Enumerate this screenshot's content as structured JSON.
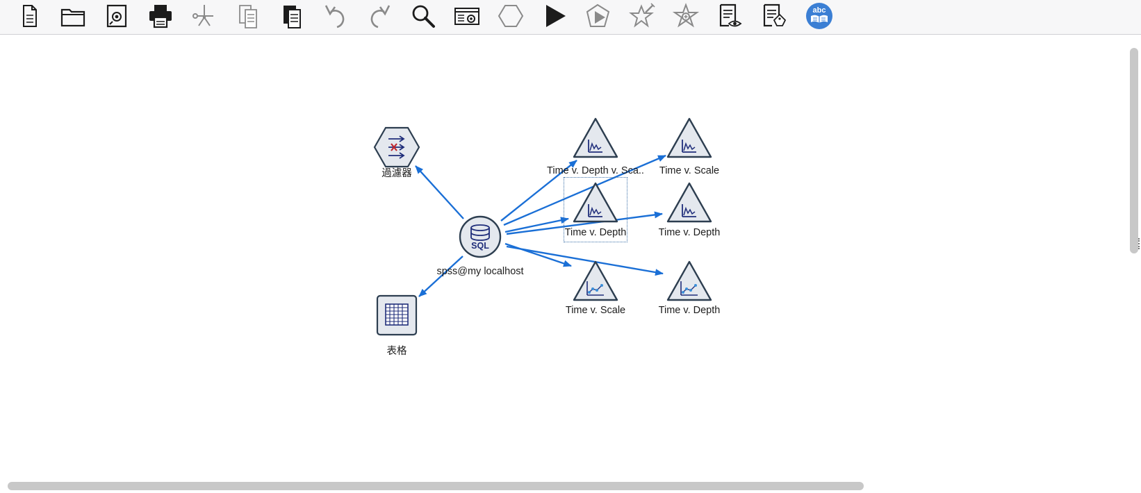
{
  "toolbar": {
    "buttons": [
      {
        "id": "new",
        "icon": "new-file-icon",
        "enabled": true
      },
      {
        "id": "open",
        "icon": "open-folder-icon",
        "enabled": true
      },
      {
        "id": "save",
        "icon": "save-icon",
        "enabled": true
      },
      {
        "id": "print",
        "icon": "print-icon",
        "enabled": true
      },
      {
        "id": "cut",
        "icon": "cut-icon",
        "enabled": false
      },
      {
        "id": "copy",
        "icon": "copy-icon",
        "enabled": false
      },
      {
        "id": "paste",
        "icon": "paste-icon",
        "enabled": true
      },
      {
        "id": "undo",
        "icon": "undo-icon",
        "enabled": false
      },
      {
        "id": "redo",
        "icon": "redo-icon",
        "enabled": false
      },
      {
        "id": "search",
        "icon": "search-icon",
        "enabled": true
      },
      {
        "id": "stream-properties",
        "icon": "stream-properties-icon",
        "enabled": true
      },
      {
        "id": "supernode",
        "icon": "supernode-icon",
        "enabled": false
      },
      {
        "id": "run",
        "icon": "run-icon",
        "enabled": true
      },
      {
        "id": "run-selection",
        "icon": "run-selection-icon",
        "enabled": false
      },
      {
        "id": "model-star",
        "icon": "star-wand-icon",
        "enabled": false
      },
      {
        "id": "model-zoom",
        "icon": "star-zoom-icon",
        "enabled": false
      },
      {
        "id": "preview",
        "icon": "preview-icon",
        "enabled": true
      },
      {
        "id": "annotate",
        "icon": "annotate-icon",
        "enabled": true
      },
      {
        "id": "text-analytics",
        "icon": "text-analytics-icon",
        "enabled": true
      }
    ],
    "text_analytics_label": "abc"
  },
  "stream": {
    "source": {
      "label": "spss@my localhost",
      "icon_text": "SQL"
    },
    "nodes": [
      {
        "id": "filter",
        "label": "過濾器",
        "type": "filter"
      },
      {
        "id": "table",
        "label": "表格",
        "type": "table"
      },
      {
        "id": "plot1",
        "label": "Time v. Depth v. Sca..",
        "type": "plot"
      },
      {
        "id": "plot2",
        "label": "Time v. Scale",
        "type": "plot"
      },
      {
        "id": "plot3",
        "label": "Time v. Depth",
        "type": "plot",
        "selected": true
      },
      {
        "id": "plot4",
        "label": "Time v. Depth",
        "type": "plot"
      },
      {
        "id": "plot5",
        "label": "Time v. Scale",
        "type": "multiplot"
      },
      {
        "id": "plot6",
        "label": "Time v. Depth",
        "type": "multiplot"
      }
    ],
    "connections": [
      {
        "from": "source",
        "to": "filter"
      },
      {
        "from": "source",
        "to": "table"
      },
      {
        "from": "source",
        "to": "plot1"
      },
      {
        "from": "source",
        "to": "plot2"
      },
      {
        "from": "source",
        "to": "plot3"
      },
      {
        "from": "source",
        "to": "plot4"
      },
      {
        "from": "source",
        "to": "plot5"
      },
      {
        "from": "source",
        "to": "plot6"
      }
    ]
  },
  "colors": {
    "link": "#1a6fd6",
    "node_fill": "#e4e8ee",
    "node_stroke": "#2d3e50",
    "icon_navy": "#1f2d7a",
    "filter_red": "#c0272d",
    "selection": "#3a6fa8",
    "text_analytics_blue": "#3b7fd4"
  }
}
